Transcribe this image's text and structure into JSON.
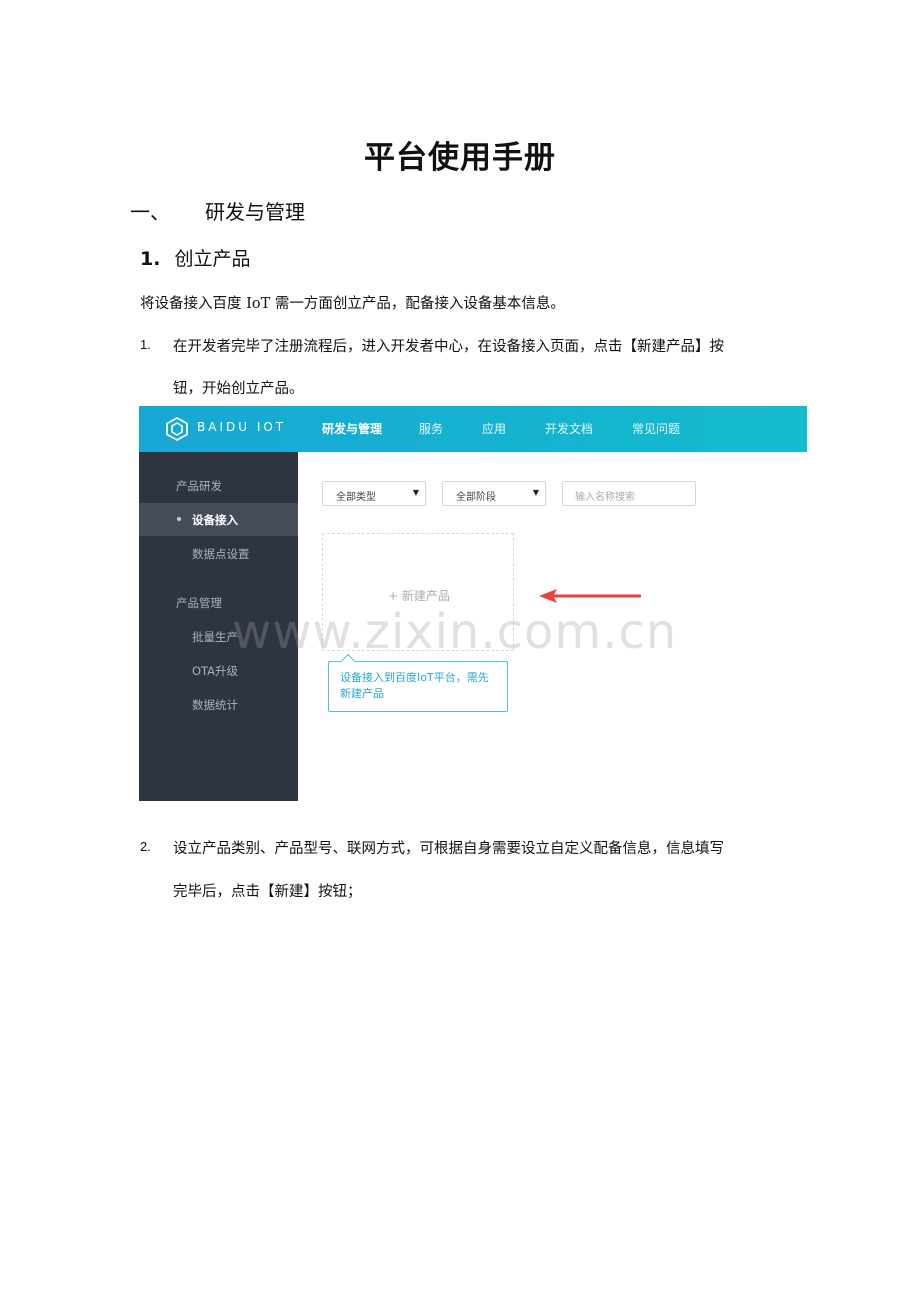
{
  "document": {
    "title": "平台使用手册",
    "section": {
      "number": "一、",
      "title": "研发与管理"
    },
    "subsection": {
      "number": "1.",
      "title": "创立产品"
    },
    "intro": "将设备接入百度 IoT 需一方面创立产品，配备接入设备基本信息。",
    "steps": [
      {
        "number": "1.",
        "line1": "在开发者完毕了注册流程后，进入开发者中心，在设备接入页面，点击【新建产品】按",
        "line2": "钮，开始创立产品。"
      },
      {
        "number": "2.",
        "line1": "设立产品类别、产品型号、联网方式，可根据自身需要设立自定义配备信息，信息填写",
        "line2": "完毕后，点击【新建】按钮；"
      }
    ],
    "watermark": "www.zixin.com.cn"
  },
  "screenshot": {
    "brand": "BAIDU IOT",
    "nav": [
      "研发与管理",
      "服务",
      "应用",
      "开发文档",
      "常见问题"
    ],
    "sidebar": {
      "group1": "产品研发",
      "group1_items": [
        "设备接入",
        "数据点设置"
      ],
      "group2": "产品管理",
      "group2_items": [
        "批量生产",
        "OTA升级",
        "数据统计"
      ]
    },
    "filters": {
      "type_select": "全部类型",
      "stage_select": "全部阶段",
      "search_placeholder": "输入名称搜索"
    },
    "new_product": "+ 新建产品",
    "tooltip": [
      "设备接入到百度IoT平台，需先",
      "新建产品"
    ],
    "colors": {
      "topbar": "#15b3d0",
      "sidebar": "#2e3440",
      "tooltip": "#2aa6d1",
      "arrow": "#e8423f"
    }
  }
}
